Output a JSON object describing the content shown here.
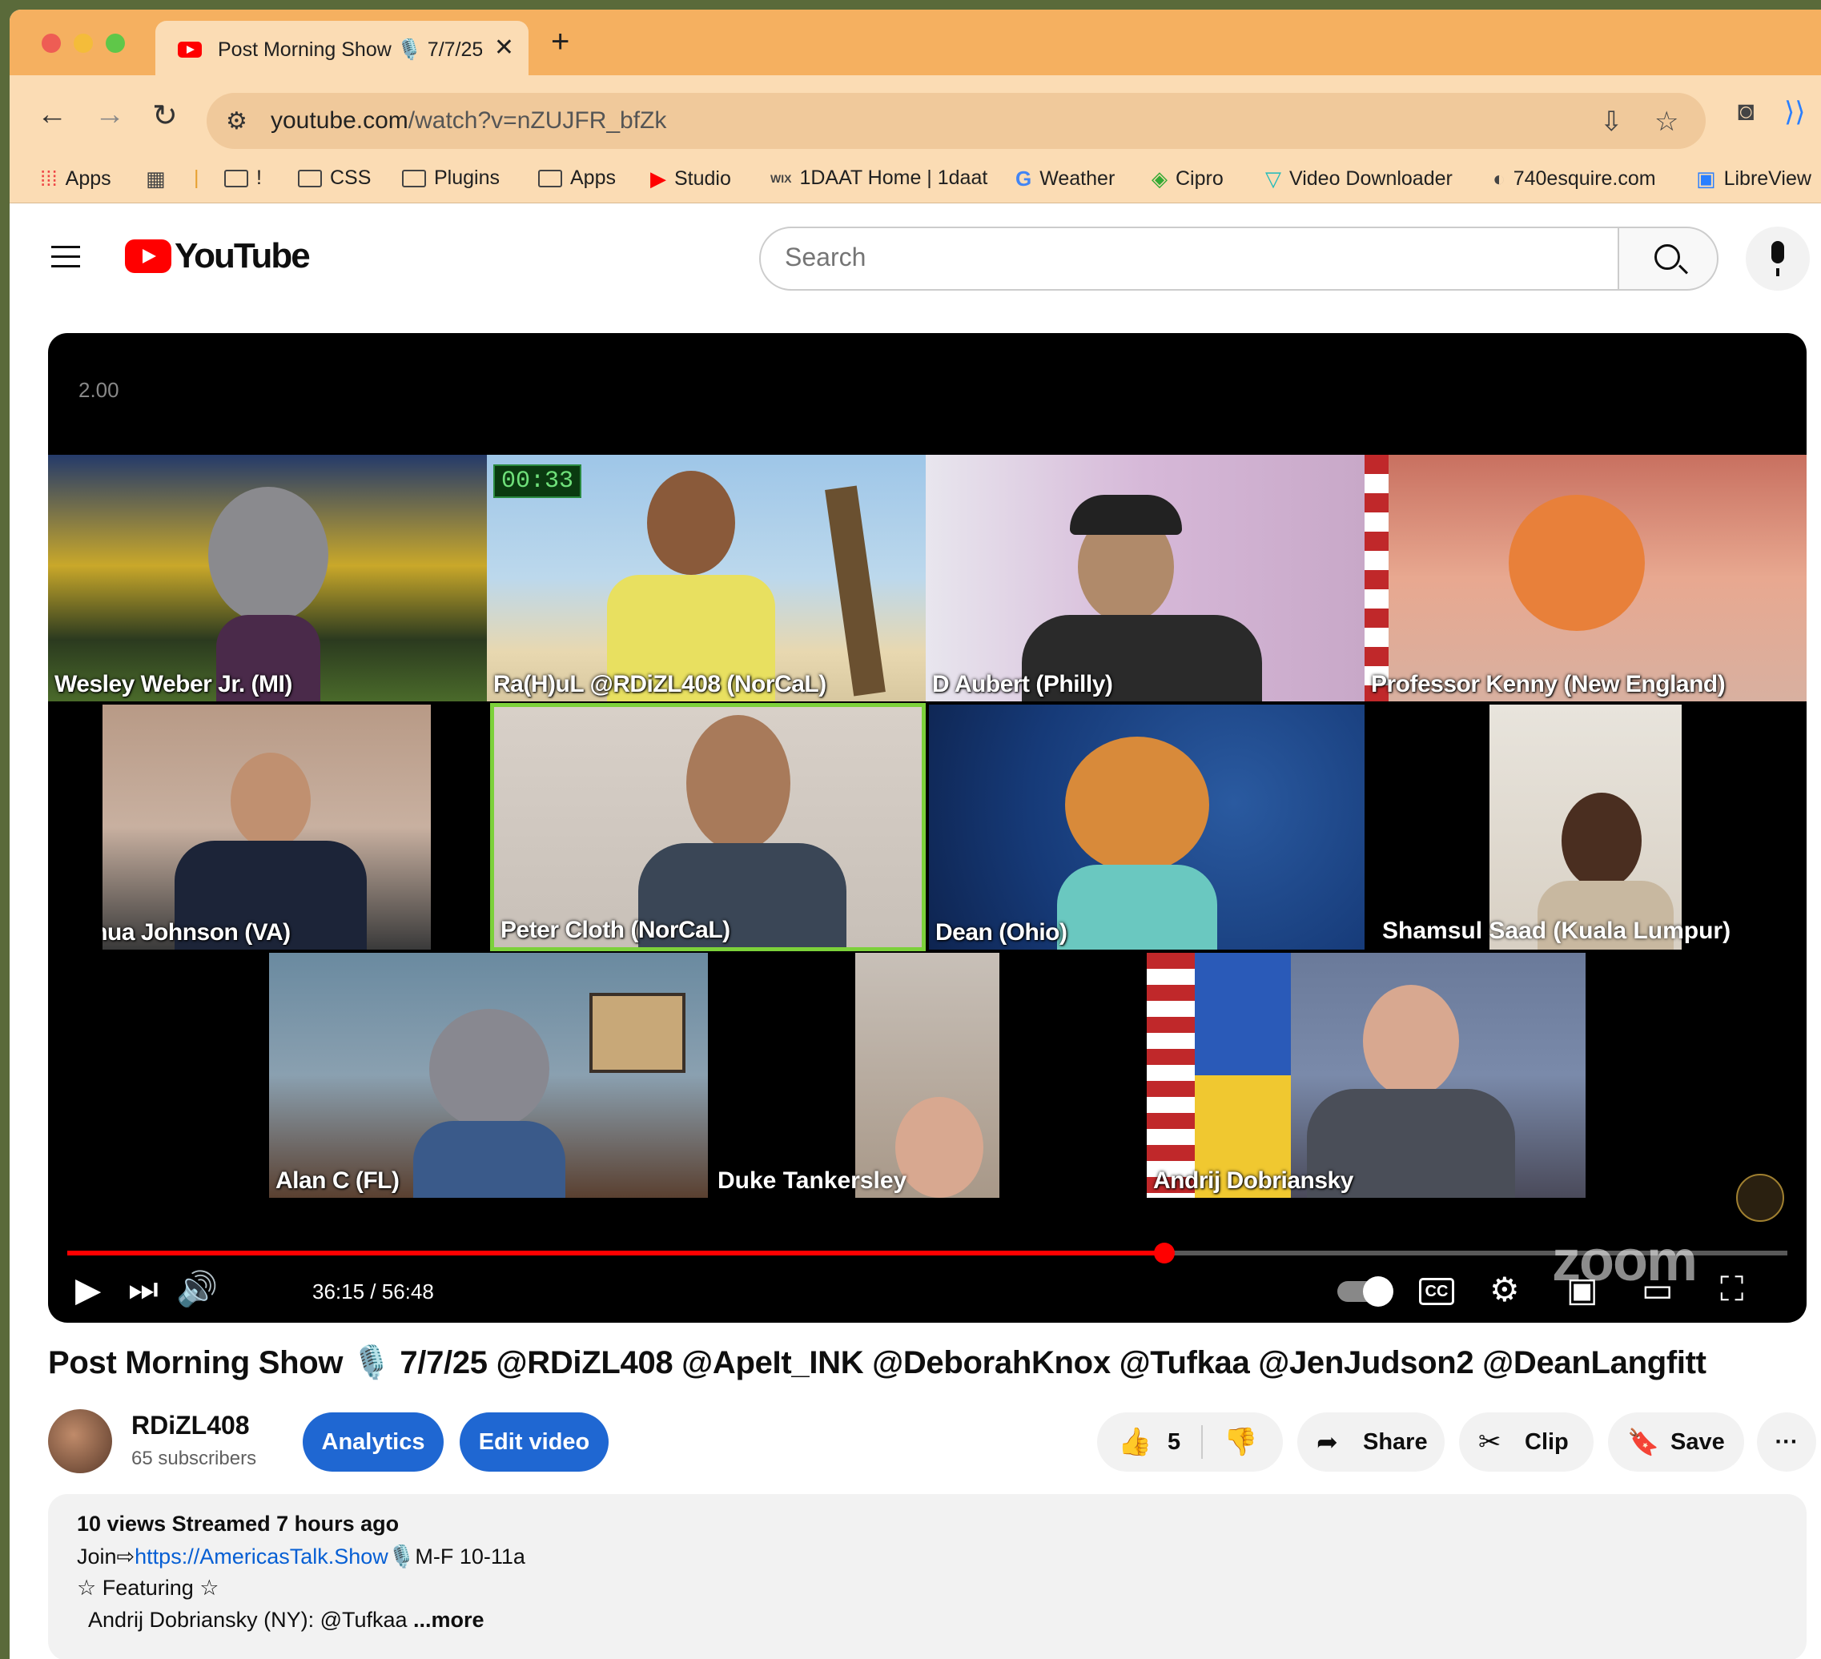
{
  "browser": {
    "tab_title": "Post Morning Show 🎙️ 7/7/25",
    "url_host": "youtube.com",
    "url_path": "/watch?v=nZUJFR_bfZk",
    "bookmarks": [
      "Apps",
      "!",
      "CSS",
      "Plugins",
      "Apps",
      "Studio",
      "1DAAT Home | 1daat",
      "Weather",
      "Cipro",
      "Video Downloader",
      "740esquire.com",
      "LibreView"
    ]
  },
  "youtube": {
    "logo_text": "YouTube",
    "search_placeholder": "Search"
  },
  "player": {
    "speed_label": "2.00",
    "timer": "00:33",
    "current_time": "36:15",
    "duration": "56:48",
    "time_display": "36:15 / 56:48",
    "progress_fraction": 0.638,
    "watermark": "zoom",
    "cc_label": "CC",
    "participants": [
      "Wesley Weber Jr. (MI)",
      "Ra(H)uL @RDiZL408 (NorCaL)",
      "D Aubert (Philly)",
      "Professor Kenny (New England)",
      "Joshua Johnson (VA)",
      "Peter Cloth (NorCaL)",
      "Dean (Ohio)",
      "Shamsul Saad (Kuala Lumpur)",
      "Alan C (FL)",
      "Duke Tankersley",
      "Andrij Dobriansky"
    ],
    "active_speaker": "Peter Cloth (NorCaL)"
  },
  "video": {
    "title": "Post Morning Show 🎙️ 7/7/25 @RDiZL408 @ApeIt_INK @DeborahKnox @Tufkaa @JenJudson2 @DeanLangfitt",
    "channel_name": "RDiZL408",
    "subscribers": "65 subscribers",
    "analytics_label": "Analytics",
    "edit_label": "Edit video",
    "likes": "5",
    "share_label": "Share",
    "clip_label": "Clip",
    "save_label": "Save",
    "more_label": "···"
  },
  "description": {
    "stats": "10 views  Streamed 7 hours ago",
    "line1_prefix": "Join⇨",
    "line1_link": "https://AmericasTalk.Show",
    "line1_suffix": "🎙️M-F 10-11a",
    "line2": "☆ Featuring ☆",
    "line3": "Andrij Dobriansky (NY): @Tufkaa",
    "more": "...more"
  }
}
